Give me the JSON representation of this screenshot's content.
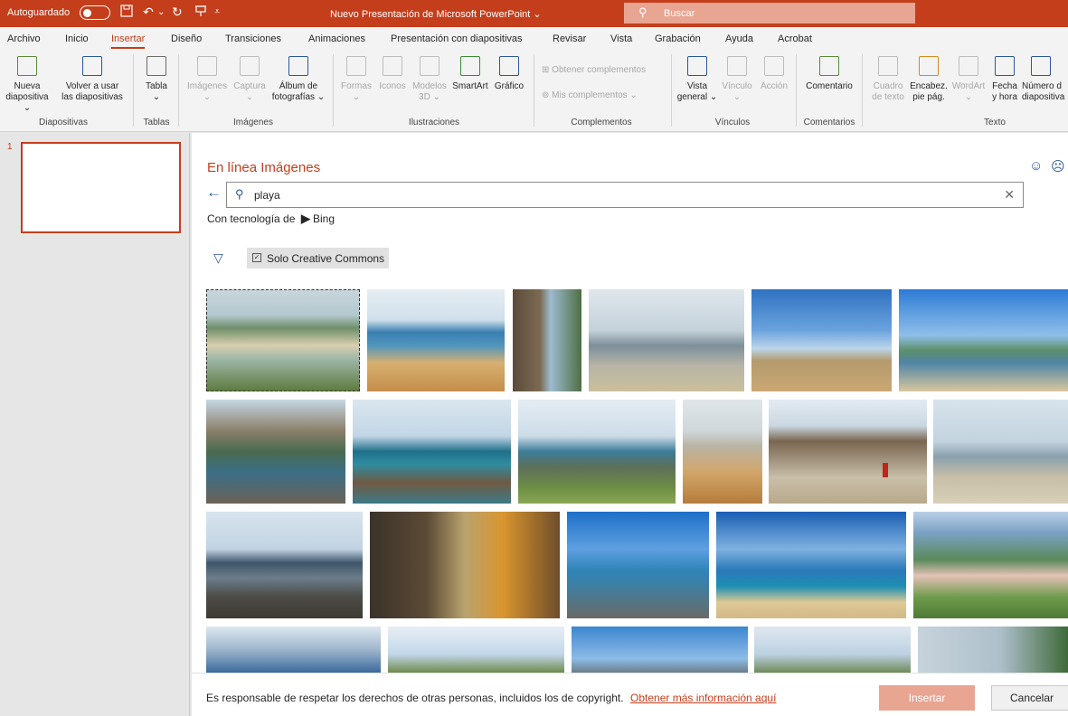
{
  "titlebar": {
    "autosave_label": "Autoguardado",
    "doc_title": "Nuevo Presentación de Microsoft PowerPoint",
    "doc_title_chevron": "⌄",
    "search_placeholder": "Buscar",
    "icons": [
      "save-icon",
      "undo-icon",
      "redo-icon",
      "present-icon",
      "customize-icon"
    ]
  },
  "menu": {
    "tabs": [
      "Archivo",
      "Inicio",
      "Insertar",
      "Diseño",
      "Transiciones",
      "Animaciones",
      "Presentación con diapositivas",
      "Revisar",
      "Vista",
      "Grabación",
      "Ayuda",
      "Acrobat"
    ],
    "active": "Insertar"
  },
  "ribbon": {
    "diapositivas": {
      "new_slide_1": "Nueva",
      "new_slide_2": "diapositiva ⌄",
      "reuse_1": "Volver a usar",
      "reuse_2": "las diapositivas",
      "label": "Diapositivas"
    },
    "tablas": {
      "table": "Tabla",
      "table_chevron": "⌄",
      "label": "Tablas"
    },
    "imagenes": {
      "images": "Imágenes",
      "images_chevron": "⌄",
      "capture": "Captura",
      "capture_chevron": "⌄",
      "album_1": "Álbum de",
      "album_2": "fotografías ⌄",
      "label": "Imágenes"
    },
    "ilustraciones": {
      "shapes": "Formas",
      "shapes_chevron": "⌄",
      "icons": "Iconos",
      "models_1": "Modelos",
      "models_2": "3D ⌄",
      "smartart": "SmartArt",
      "chart": "Gráfico",
      "label": "Ilustraciones"
    },
    "complementos": {
      "get": "Obtener complementos",
      "mine": "Mis complementos",
      "mine_chevron": "⌄",
      "label": "Complementos"
    },
    "vinculos": {
      "overview_1": "Vista",
      "overview_2": "general ⌄",
      "link": "Vínculo",
      "link_chevron": "⌄",
      "action": "Acción",
      "label": "Vínculos"
    },
    "comentarios": {
      "comment": "Comentario",
      "label": "Comentarios"
    },
    "texto": {
      "textbox_1": "Cuadro",
      "textbox_2": "de texto",
      "header_1": "Encabez.",
      "header_2": "pie pág.",
      "wordart": "WordArt",
      "wordart_chevron": "⌄",
      "date_1": "Fecha",
      "date_2": "y hora",
      "number_1": "Número d",
      "number_2": "diapositiva",
      "label": "Texto"
    }
  },
  "slides_panel": {
    "slide_number": "1"
  },
  "dialog": {
    "title": "En línea Imágenes",
    "search_value": "playa",
    "powered_by": "Con tecnología de",
    "bing": "Bing",
    "filter_label": "Solo Creative Commons",
    "footer_note": "Es responsable de respetar los derechos de otras personas, incluidos los de copyright.",
    "footer_link": "Obtener más información aquí",
    "insert_button": "Insertar",
    "cancel_button": "Cancelar"
  },
  "colors": {
    "accent": "#c43e1c",
    "link_blue": "#2b579a",
    "insert_disabled": "#e8a592"
  }
}
